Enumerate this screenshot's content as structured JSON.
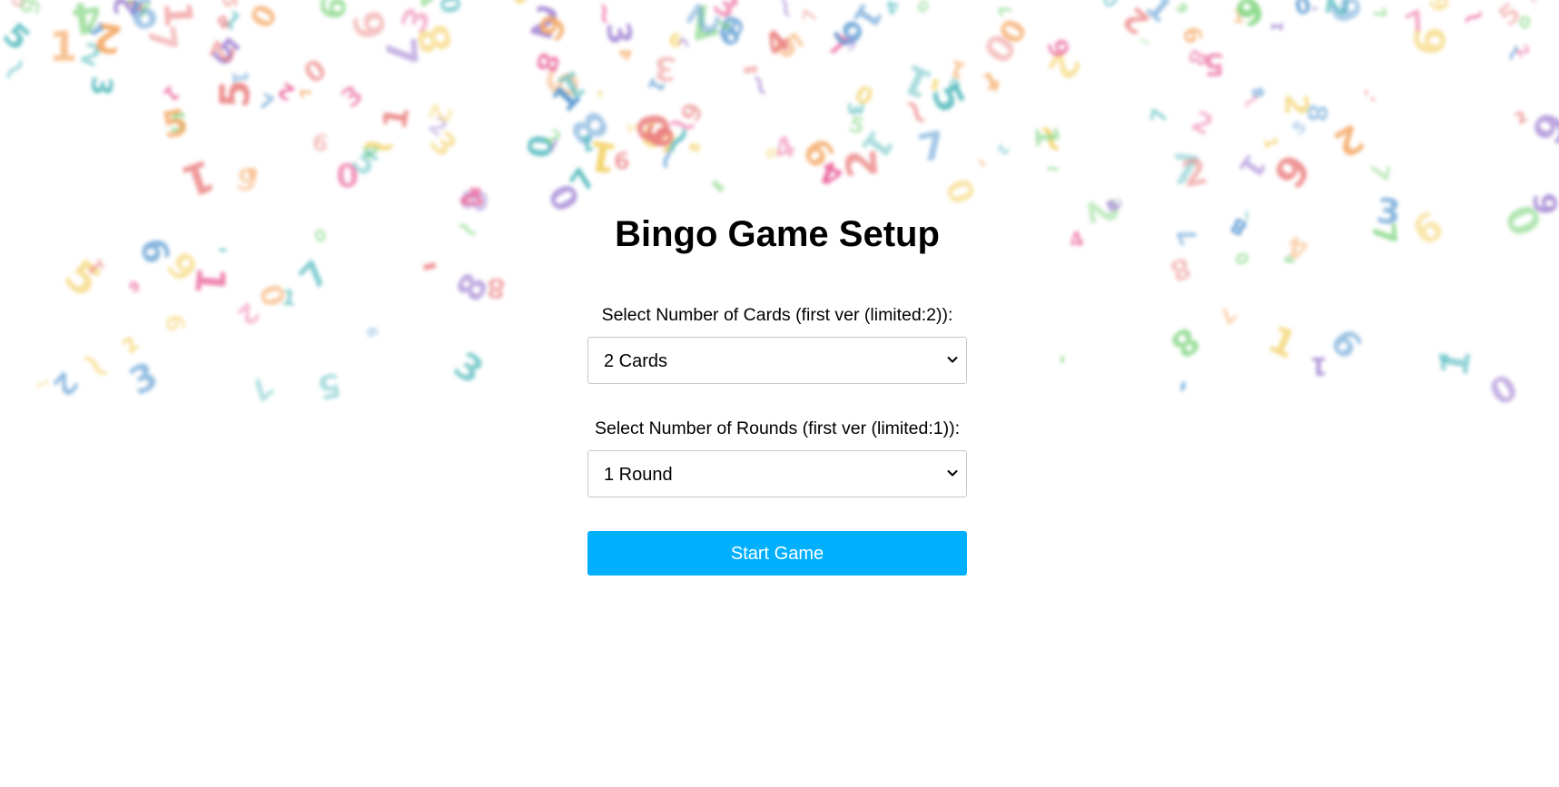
{
  "page": {
    "title": "Bingo Game Setup",
    "background_color": "#ffffff",
    "accent_color": "#00b0ff",
    "decoration": "confetti-numbers"
  },
  "setup": {
    "cards_label": "Select Number of Cards (first ver (limited:2)):",
    "cards_selected": "2 Cards",
    "rounds_label": "Select Number of Rounds (first ver (limited:1)):",
    "rounds_selected": "1 Round",
    "start_label": "Start Game",
    "select_icon": "chevron-down-icon"
  },
  "confetti": {
    "palette": [
      "#e8508f",
      "#3c87c9",
      "#3fb1b5",
      "#f2c94c",
      "#f2994a",
      "#9b7bd0",
      "#6fcf6f",
      "#e86a6a"
    ]
  }
}
